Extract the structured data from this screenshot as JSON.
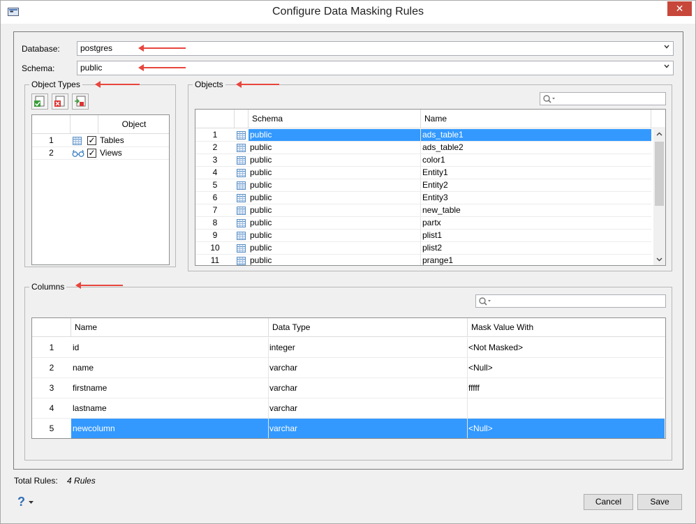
{
  "window": {
    "title": "Configure Data Masking Rules",
    "close_label": "✕"
  },
  "database": {
    "label": "Database:",
    "value": "postgres"
  },
  "schema": {
    "label": "Schema:",
    "value": "public"
  },
  "object_types": {
    "group_label": "Object Types",
    "column_header": "Object",
    "rows": [
      {
        "num": "1",
        "name": "Tables",
        "checked": "✓",
        "icon": "table-icon"
      },
      {
        "num": "2",
        "name": "Views",
        "checked": "✓",
        "icon": "view-icon"
      }
    ]
  },
  "objects": {
    "group_label": "Objects",
    "columns": [
      "Schema",
      "Name"
    ],
    "rows": [
      {
        "num": "1",
        "schema": "public",
        "name": "ads_table1"
      },
      {
        "num": "2",
        "schema": "public",
        "name": "ads_table2"
      },
      {
        "num": "3",
        "schema": "public",
        "name": "color1"
      },
      {
        "num": "4",
        "schema": "public",
        "name": "Entity1"
      },
      {
        "num": "5",
        "schema": "public",
        "name": "Entity2"
      },
      {
        "num": "6",
        "schema": "public",
        "name": "Entity3"
      },
      {
        "num": "7",
        "schema": "public",
        "name": "new_table"
      },
      {
        "num": "8",
        "schema": "public",
        "name": "partx"
      },
      {
        "num": "9",
        "schema": "public",
        "name": "plist1"
      },
      {
        "num": "10",
        "schema": "public",
        "name": "plist2"
      },
      {
        "num": "11",
        "schema": "public",
        "name": "prange1"
      }
    ]
  },
  "columns_section": {
    "group_label": "Columns",
    "headers": [
      "Name",
      "Data Type",
      "Mask Value With"
    ],
    "rows": [
      {
        "num": "1",
        "name": "id",
        "type": "integer",
        "mask": "<Not Masked>"
      },
      {
        "num": "2",
        "name": "name",
        "type": "varchar",
        "mask": "<Null>"
      },
      {
        "num": "3",
        "name": "firstname",
        "type": "varchar",
        "mask": "fffff"
      },
      {
        "num": "4",
        "name": "lastname",
        "type": "varchar",
        "mask": ""
      },
      {
        "num": "5",
        "name": "newcolumn",
        "type": "varchar",
        "mask": "<Null>"
      }
    ]
  },
  "footer": {
    "total_label": "Total Rules:",
    "total_value": "4 Rules",
    "help_label": "?",
    "cancel_label": "Cancel",
    "save_label": "Save"
  },
  "colors": {
    "selection": "#3399ff",
    "annotation_arrow": "#e8463d",
    "close_button": "#c7473b"
  }
}
